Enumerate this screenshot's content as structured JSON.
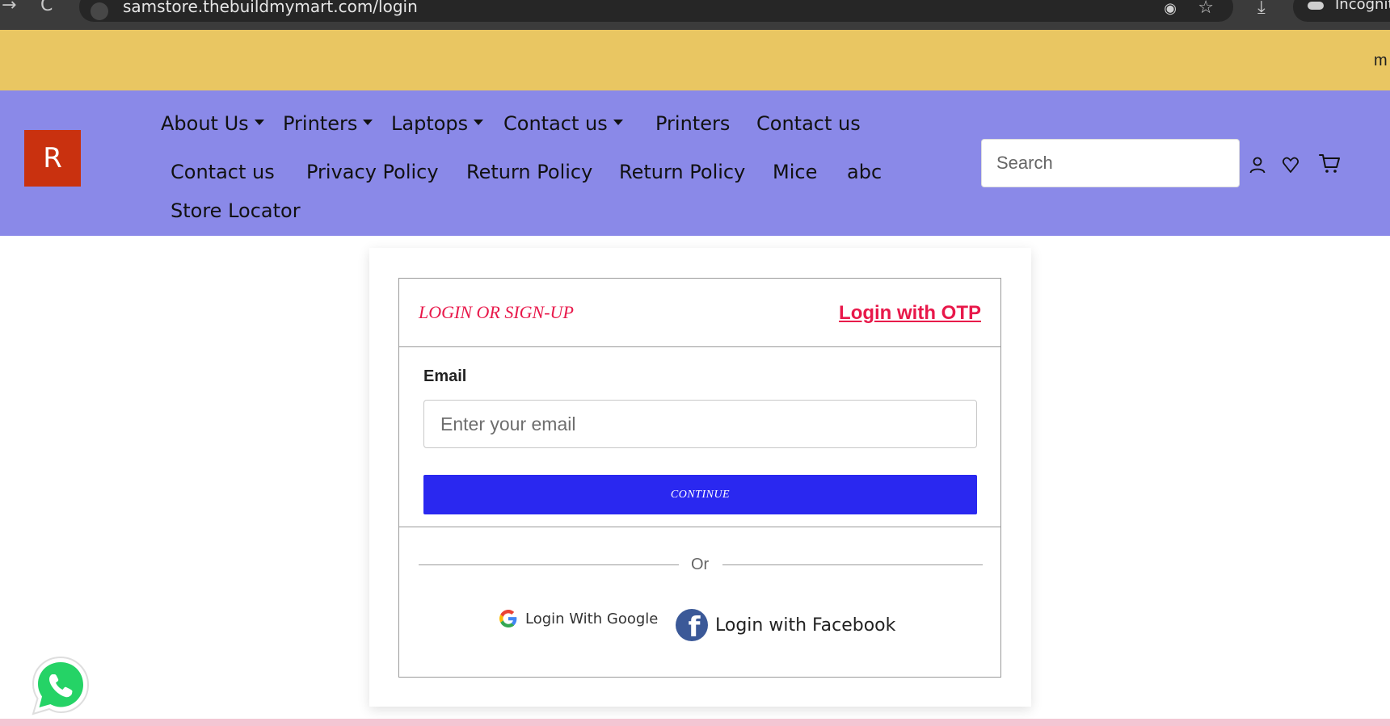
{
  "browser": {
    "url": "samstore.thebuildmymart.com/login",
    "profile_label": "Incognito",
    "back_glyph": "→",
    "reload_glyph": "C"
  },
  "announcement": {
    "text": "m"
  },
  "header": {
    "logo_letter": "R",
    "nav_row1": [
      {
        "label": "About Us",
        "dropdown": true
      },
      {
        "label": "Printers",
        "dropdown": true
      },
      {
        "label": "Laptops",
        "dropdown": true
      },
      {
        "label": "Contact us",
        "dropdown": true
      },
      {
        "label": "Printers",
        "dropdown": false
      },
      {
        "label": "Contact us",
        "dropdown": false
      }
    ],
    "nav_row2": [
      "Contact us",
      "Privacy Policy",
      "Return Policy",
      "Return Policy",
      "Mice",
      "abc"
    ],
    "nav_row3": [
      "Store Locator"
    ],
    "search_placeholder": "Search",
    "icons": [
      "user-icon",
      "heart-icon",
      "cart-icon"
    ]
  },
  "login": {
    "title": "LOGIN OR SIGN-UP",
    "otp_link": "Login with OTP",
    "email_label": "Email",
    "email_placeholder": "Enter your email",
    "continue_label": "CONTINUE",
    "or_text": "Or",
    "google_label": "Login With Google",
    "facebook_label": "Login with Facebook"
  },
  "colors": {
    "announcement_bg": "#e9c662",
    "header_bg": "#8a89e8",
    "logo_bg": "#c9310f",
    "accent_pink": "#e8184a",
    "continue_bg": "#2a28f0",
    "facebook_blue": "#3b5998",
    "whatsapp_green": "#25d366"
  }
}
